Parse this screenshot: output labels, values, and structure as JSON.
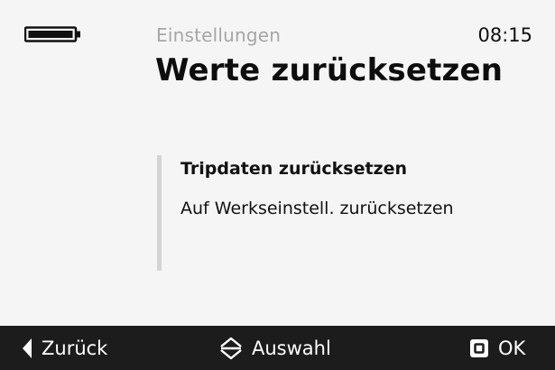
{
  "status": {
    "battery": {
      "icon": "battery-icon",
      "level": 1.0
    },
    "time": "08:15"
  },
  "header": {
    "section": "Einstellungen",
    "title": "Werte zurücksetzen"
  },
  "menu": {
    "items": [
      {
        "label": "Tripdaten zurücksetzen",
        "selected": true
      },
      {
        "label": "Auf Werkseinstell. zurücksetzen",
        "selected": false
      }
    ]
  },
  "footer": {
    "back": {
      "icon": "triangle-left-icon",
      "label": "Zurück"
    },
    "select": {
      "icon": "up-down-arrows-icon",
      "label": "Auswahl"
    },
    "ok": {
      "icon": "square-button-icon",
      "label": "OK"
    }
  },
  "colors": {
    "background": "#f5f5f5",
    "footer": "#1c1c1c",
    "muted": "#a6a6a6",
    "text": "#111111"
  }
}
